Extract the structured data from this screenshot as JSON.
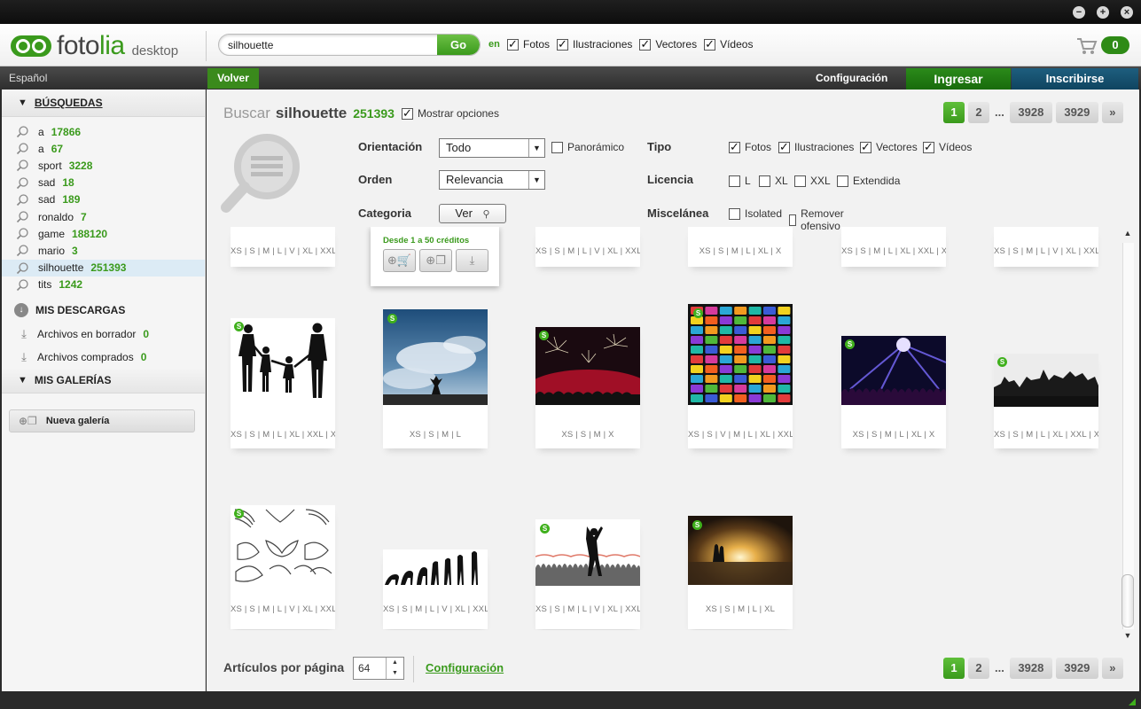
{
  "window": {
    "title": "fotolia desktop",
    "buttons": [
      "−",
      "+",
      "×"
    ]
  },
  "header": {
    "logo_main": "foto",
    "logo_accent": "lia",
    "logo_sub": "desktop",
    "search_value": "silhouette",
    "go_label": "Go",
    "en_label": "en",
    "types": [
      {
        "label": "Fotos",
        "checked": true
      },
      {
        "label": "Ilustraciones",
        "checked": true
      },
      {
        "label": "Vectores",
        "checked": true
      },
      {
        "label": "Vídeos",
        "checked": true
      }
    ],
    "cart_icon": "shopping-cart-icon",
    "cart_count": "0"
  },
  "nav": {
    "language": "Español",
    "back": "Volver",
    "config": "Configuración",
    "login": "Ingresar",
    "signup": "Inscribirse"
  },
  "sidebar": {
    "searches_title": "BÚSQUEDAS",
    "searches": [
      {
        "term": "a",
        "count": "17866"
      },
      {
        "term": "a",
        "count": "67"
      },
      {
        "term": "sport",
        "count": "3228"
      },
      {
        "term": "sad",
        "count": "18"
      },
      {
        "term": "sad",
        "count": "189"
      },
      {
        "term": "ronaldo",
        "count": "7"
      },
      {
        "term": "game",
        "count": "188120"
      },
      {
        "term": "mario",
        "count": "3"
      },
      {
        "term": "silhouette",
        "count": "251393",
        "active": true
      },
      {
        "term": "tits",
        "count": "1242"
      }
    ],
    "downloads_title": "MIS DESCARGAS",
    "downloads": [
      {
        "label": "Archivos en borrador",
        "count": "0"
      },
      {
        "label": "Archivos comprados",
        "count": "0"
      }
    ],
    "galleries_title": "MIS GALERÍAS",
    "new_gallery": "Nueva galería"
  },
  "main": {
    "search_label": "Buscar",
    "query": "silhouette",
    "count": "251393",
    "show_options": "Mostrar opciones",
    "pages": [
      "1",
      "2",
      "...",
      "3928",
      "3929",
      "»"
    ],
    "current_page": "1",
    "filters": {
      "orientation_label": "Orientación",
      "orientation_value": "Todo",
      "panoramic": "Panorámico",
      "order_label": "Orden",
      "order_value": "Relevancia",
      "category_label": "Categoria",
      "category_btn": "Ver",
      "type_label": "Tipo",
      "types": [
        "Fotos",
        "Ilustraciones",
        "Vectores",
        "Vídeos"
      ],
      "license_label": "Licencia",
      "licenses": [
        "L",
        "XL",
        "XXL",
        "Extendida"
      ],
      "misc_label": "Miscelánea",
      "misc": [
        "Isolated",
        "Remover ofensivo"
      ]
    },
    "popup": {
      "text": "Desde 1 a 50 créditos"
    },
    "top_row_sizes": [
      "XS | S | M | L | V | XL | XXL | X",
      "",
      "XS | S | M | L | V | XL | XXL | X",
      "XS | S | M | L | XL | X",
      "XS | S | M | L | XL | XXL | X",
      "XS | S | M | L | V | XL | XXL | X"
    ],
    "row2": [
      {
        "name": "family-silhouette",
        "sizes": "XS | S | M | L | XL | XXL | X"
      },
      {
        "name": "sky-jump",
        "sizes": "XS | S | M | L"
      },
      {
        "name": "fireworks-crowd",
        "sizes": "XS | S | M | X"
      },
      {
        "name": "color-grid",
        "sizes": "XS | S | V | M | L | XL | XXL | X"
      },
      {
        "name": "concert-lights",
        "sizes": "XS | S | M | L | XL | X"
      },
      {
        "name": "band-silhouette",
        "sizes": "XS | S | M | L | XL | XXL | X"
      }
    ],
    "row3": [
      {
        "name": "wings-set",
        "sizes": "XS | S | M | L | V | XL | XXL | X"
      },
      {
        "name": "evolution",
        "sizes": "XS | S | M | L | V | XL | XXL | X"
      },
      {
        "name": "runners-finish",
        "sizes": "XS | S | M | L | V | XL | XXL | X"
      },
      {
        "name": "sunset-couple",
        "sizes": "XS | S | M | L | XL"
      }
    ],
    "per_page_label": "Artículos por página",
    "per_page_value": "64",
    "config_link": "Configuración"
  },
  "colors": {
    "brand_green": "#3a9a1c",
    "signup_blue": "#0f4460"
  }
}
